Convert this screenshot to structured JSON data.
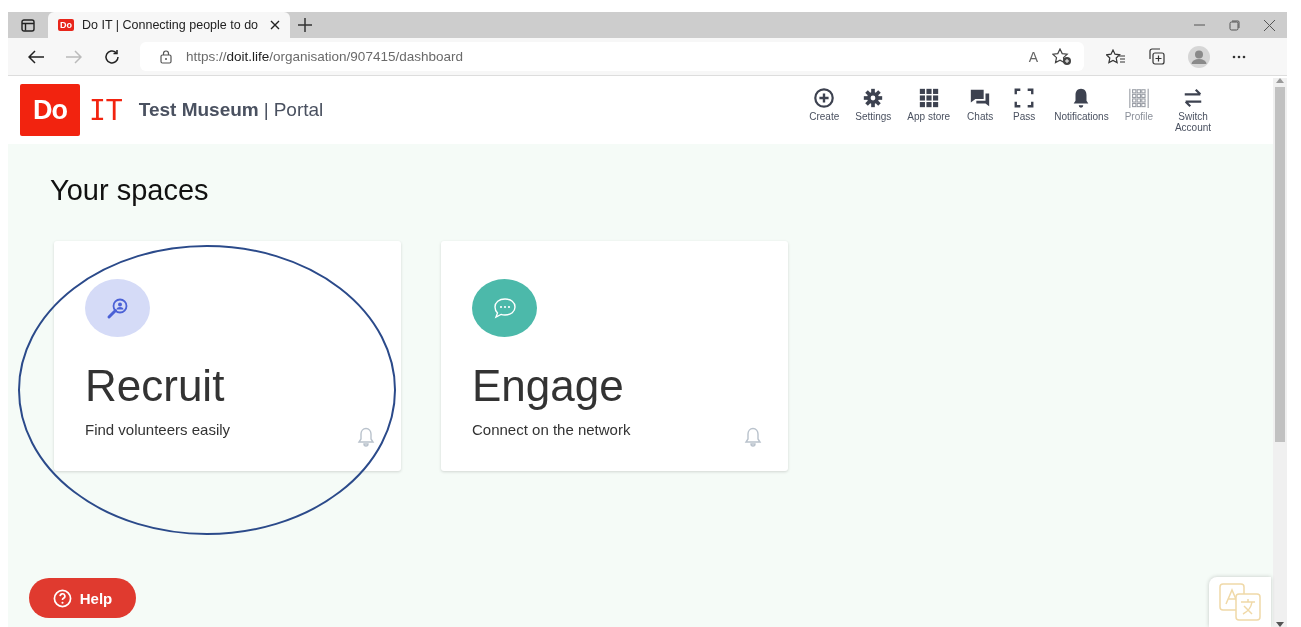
{
  "browser": {
    "tab": {
      "title": "Do IT | Connecting people to do",
      "favicon": "Do"
    },
    "url": {
      "scheme": "https://",
      "host": "doit.life",
      "path": "/organisation/907415/dashboard"
    },
    "read_aloud": "A"
  },
  "header": {
    "logo": {
      "mark": "Do",
      "text": "IT"
    },
    "org_name": "Test Museum",
    "separator": "|",
    "section": "Portal",
    "nav": [
      {
        "kind": "create",
        "label": "Create",
        "disabled": false
      },
      {
        "kind": "settings",
        "label": "Settings",
        "disabled": false
      },
      {
        "kind": "apps",
        "label": "App store",
        "disabled": false
      },
      {
        "kind": "chats",
        "label": "Chats",
        "disabled": false
      },
      {
        "kind": "pass",
        "label": "Pass",
        "disabled": false
      },
      {
        "kind": "bell",
        "label": "Notifications",
        "disabled": false
      },
      {
        "kind": "profile",
        "label": "Profile",
        "disabled": true
      },
      {
        "kind": "switch",
        "label": "Switch Account",
        "disabled": false
      }
    ]
  },
  "heading": "Your spaces",
  "spaces": [
    {
      "kind": "recruit",
      "title": "Recruit",
      "subtitle": "Find volunteers easily",
      "color": "#d5dbf7"
    },
    {
      "kind": "engage",
      "title": "Engage",
      "subtitle": "Connect on the network",
      "color": "#4cb9aa"
    }
  ],
  "annotation": {
    "kind": "ellipse"
  },
  "help": {
    "label": "Help"
  }
}
